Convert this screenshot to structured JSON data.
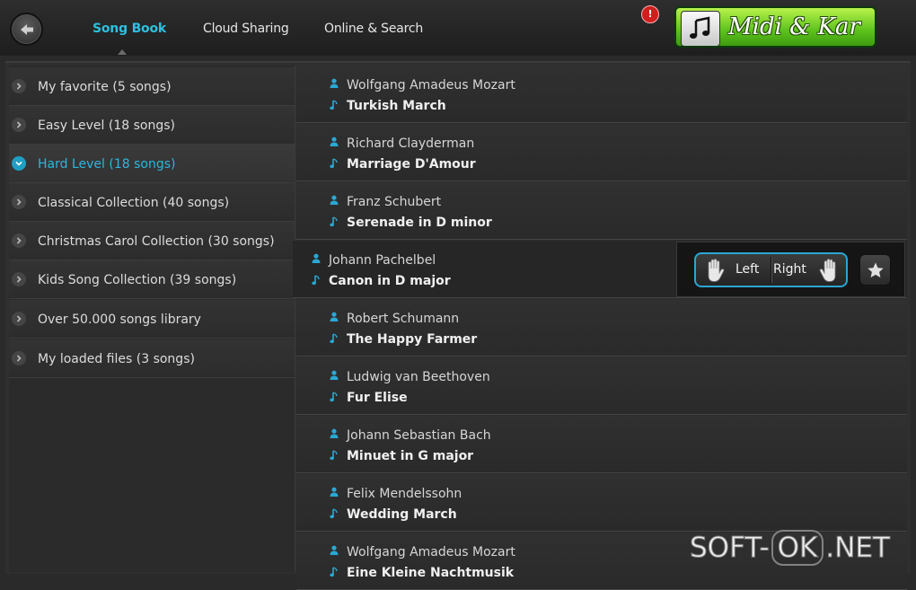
{
  "header": {
    "tabs": [
      {
        "label": "Song Book",
        "active": true
      },
      {
        "label": "Cloud Sharing",
        "active": false
      },
      {
        "label": "Online & Search",
        "active": false
      }
    ],
    "notification_count": "!",
    "logo_text": "Midi & Kar",
    "back_icon": "back-arrow-icon"
  },
  "sidebar": {
    "items": [
      {
        "label": "My favorite (5 songs)",
        "selected": false
      },
      {
        "label": "Easy Level (18 songs)",
        "selected": false
      },
      {
        "label": "Hard Level (18 songs)",
        "selected": true
      },
      {
        "label": "Classical Collection (40 songs)",
        "selected": false
      },
      {
        "label": "Christmas Carol Collection (30 songs)",
        "selected": false
      },
      {
        "label": "Kids Song Collection (39 songs)",
        "selected": false
      },
      {
        "label": "Over 50.000 songs library",
        "selected": false
      },
      {
        "label": "My loaded files (3 songs)",
        "selected": false
      }
    ]
  },
  "songs": [
    {
      "artist": "Wolfgang Amadeus Mozart",
      "title": "Turkish March"
    },
    {
      "artist": "Richard Clayderman",
      "title": "Marriage D'Amour"
    },
    {
      "artist": "Franz Schubert",
      "title": "Serenade in D minor"
    },
    {
      "artist": "Johann Pachelbel",
      "title": "Canon in D major",
      "highlighted": true
    },
    {
      "artist": "Robert Schumann",
      "title": "The Happy Farmer"
    },
    {
      "artist": "Ludwig van Beethoven",
      "title": "Fur Elise"
    },
    {
      "artist": "Johann Sebastian Bach",
      "title": "Minuet in G major"
    },
    {
      "artist": "Felix Mendelssohn",
      "title": "Wedding March"
    },
    {
      "artist": "Wolfgang Amadeus Mozart",
      "title": "Eine Kleine Nachtmusik"
    }
  ],
  "hand_control": {
    "left_label": "Left",
    "right_label": "Right"
  },
  "watermark": {
    "prefix": "SOFT-",
    "mid": "OK",
    "suffix": ".NET"
  },
  "colors": {
    "accent": "#2ab8dc",
    "background": "#2a2a2a",
    "badge": "#d01e1e",
    "logo_green": "#5cc21c"
  }
}
